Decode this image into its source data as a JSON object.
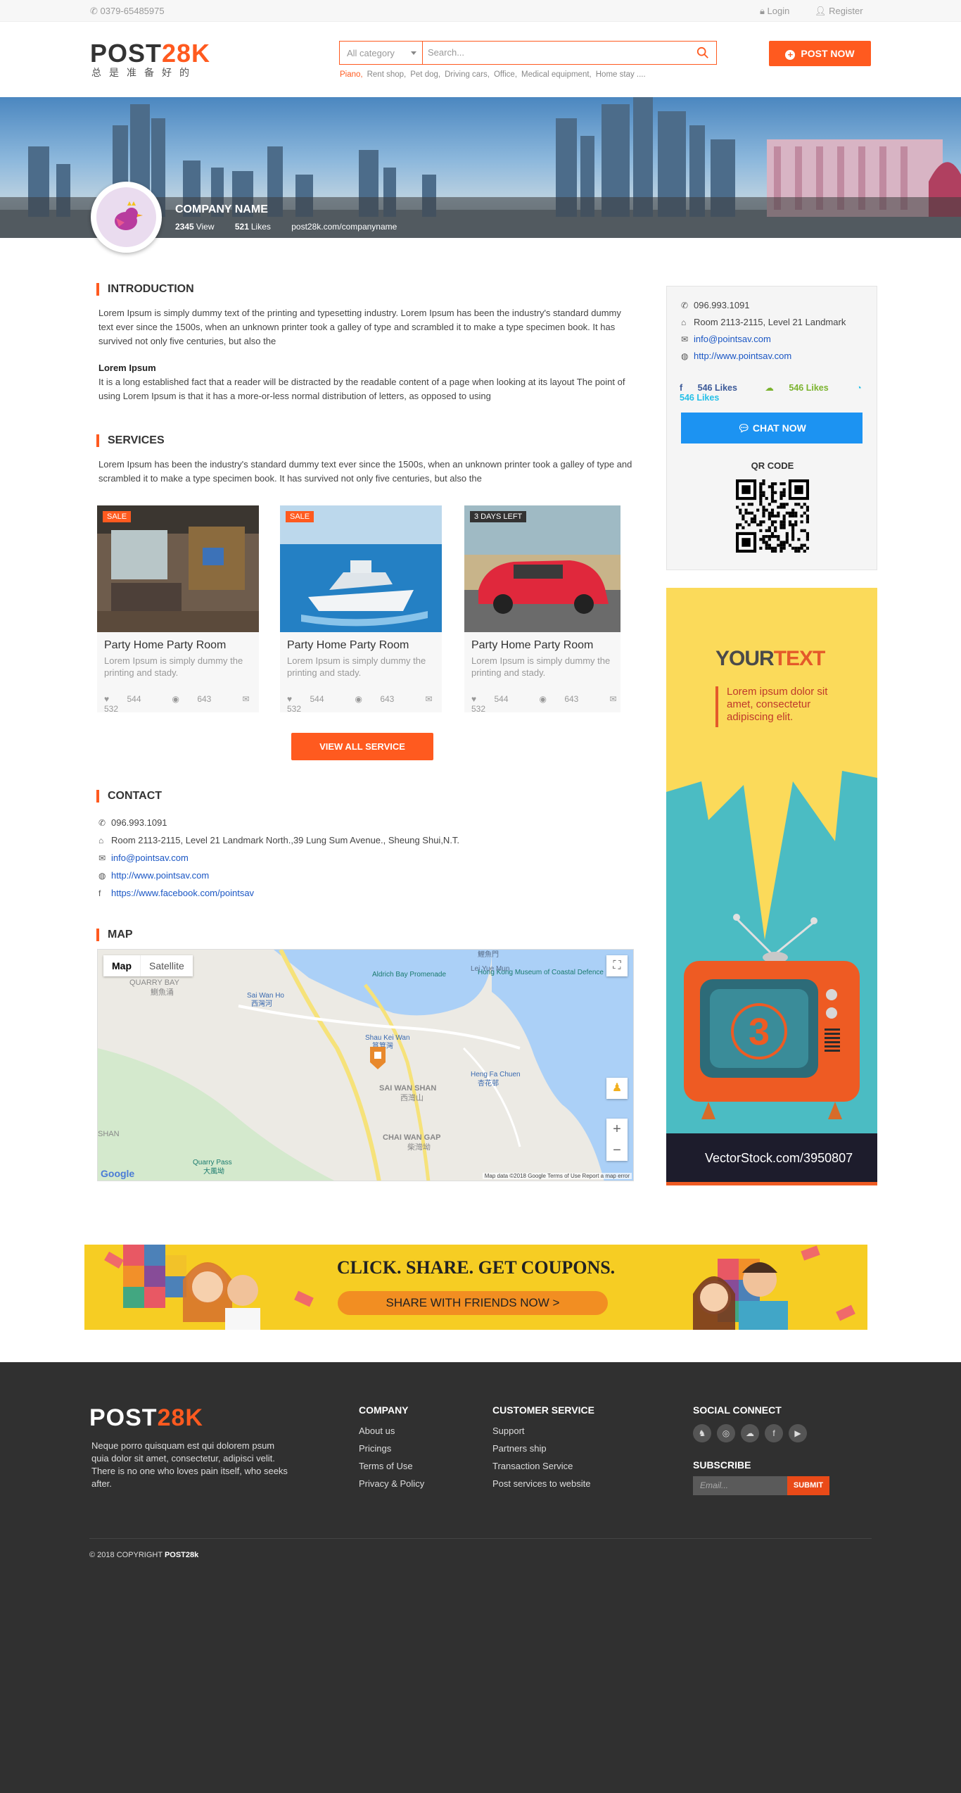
{
  "topbar": {
    "phone": "0379-65485975",
    "login": "Login",
    "register": "Register"
  },
  "header": {
    "logo_main": "POST",
    "logo_accent": "28K",
    "logo_sub": "总是准备好的",
    "category": "All category",
    "search_placeholder": "Search...",
    "hotkeys": [
      "Piano,",
      "Rent shop,",
      "Pet dog,",
      "Driving cars,",
      "Office,",
      "Medical equipment,",
      "Home stay ...."
    ],
    "post_now": "POST NOW"
  },
  "company": {
    "name": "COMPANY NAME",
    "views": "2345",
    "views_label": "View",
    "likes": "521",
    "likes_label": "Likes",
    "url": "post28k.com/companyname"
  },
  "intro": {
    "title": "INTRODUCTION",
    "text": "Lorem Ipsum is simply dummy text of the printing and typesetting industry. Lorem Ipsum has been the industry's standard dummy text ever since the 1500s, when an unknown printer took a galley of type and scrambled it to make a type specimen book. It has survived not only five centuries, but also the",
    "subtitle": "Lorem Ipsum",
    "subtext": "It is a long established fact that a reader will be distracted by the readable content of a page when looking at its layout The point of using Lorem Ipsum is that it has a more-or-less normal distribution of letters, as opposed to using"
  },
  "services": {
    "title": "SERVICES",
    "text": "Lorem Ipsum has been the industry's standard dummy text ever since the 1500s, when an unknown printer took a galley of type and scrambled it to make a type specimen book. It has survived not only five centuries, but also the",
    "cards": [
      {
        "tag": "SALE",
        "title": "Party Home Party Room",
        "desc": "Lorem Ipsum is simply dummy the printing and  stady.",
        "likes": "544",
        "views": "643",
        "comments": "532"
      },
      {
        "tag": "SALE",
        "title": "Party Home Party Room",
        "desc": "Lorem Ipsum is simply dummy the printing and  stady.",
        "likes": "544",
        "views": "643",
        "comments": "532"
      },
      {
        "tag": "3 DAYS LEFT",
        "title": "Party Home Party Room",
        "desc": "Lorem Ipsum is simply dummy the printing and  stady.",
        "likes": "544",
        "views": "643",
        "comments": "532"
      }
    ],
    "view_all": "VIEW ALL SERVICE"
  },
  "contact": {
    "title": "CONTACT",
    "phone": "096.993.1091",
    "address": "Room 2113-2115, Level 21 Landmark North.,39 Lung Sum Avenue., Sheung Shui,N.T.",
    "email": "info@pointsav.com",
    "website": "http://www.pointsav.com",
    "facebook": "https://www.facebook.com/pointsav"
  },
  "map": {
    "title": "MAP",
    "tab_map": "Map",
    "tab_satellite": "Satellite",
    "labels": [
      "QUARRY BAY",
      "鰂魚涌",
      "Aldrich Bay Promenade",
      "Hong Kong Museum of Coastal Defence",
      "Lei Yue Mun",
      "鯉魚門",
      "SAI WAN SHAN",
      "西灣山",
      "CHAI WAN GAP",
      "柴灣坳",
      "Quarry Pass",
      "大風坳",
      "Shau Kei Wan",
      "筲箕灣",
      "Heng Fa Chuen",
      "杏花邨",
      "Sai Wan Ho",
      "西灣河",
      "SHAN"
    ],
    "attribution": "Map data ©2018 Google   Terms of Use   Report a map error",
    "google": "Google"
  },
  "sidebar": {
    "phone": "096.993.1091",
    "address": "Room 2113-2115, Level 21 Landmark",
    "email": "info@pointsav.com",
    "website": "http://www.pointsav.com",
    "fb_likes": "546 Likes",
    "wechat_likes": "546 Likes",
    "whatsapp_likes": "546 Likes",
    "chat_now": "CHAT NOW",
    "qr_label": "QR CODE"
  },
  "ad": {
    "your": "YOUR",
    "text": "TEXT",
    "body": "Lorem ipsum dolor sit amet, consectetur adipiscing elit.",
    "tv_number": "3",
    "watermark": "VectorStock.com/3950807"
  },
  "coupon": {
    "headline": "CLICK. SHARE. GET COUPONS.",
    "cta": "SHARE WITH FRIENDS NOW  >"
  },
  "footer": {
    "logo_main": "POST",
    "logo_accent": "28K",
    "desc": "Neque porro quisquam est qui dolorem psum quia dolor sit amet, consectetur, adipisci velit. There is no one who loves pain itself, who seeks after.",
    "company_title": "COMPANY",
    "company_links": [
      "About us",
      "Pricings",
      "Terms of Use",
      "Privacy & Policy"
    ],
    "cs_title": "CUSTOMER SERVICE",
    "cs_links": [
      "Support",
      "Partners ship",
      "Transaction Service",
      "Post services to website"
    ],
    "social_title": "SOCIAL CONNECT",
    "subscribe_title": "SUBSCRIBE",
    "email_placeholder": "Email...",
    "submit": "SUBMIT",
    "copyright": "© 2018 COPYRIGHT",
    "copyright_brand": "POST28k"
  },
  "colors": {
    "accent": "#ff5a1f",
    "chat": "#1c93f2",
    "footer_bg": "#303030",
    "fb": "#3b5998",
    "wechat": "#7bb32e",
    "whatsapp": "#25c0e8"
  }
}
